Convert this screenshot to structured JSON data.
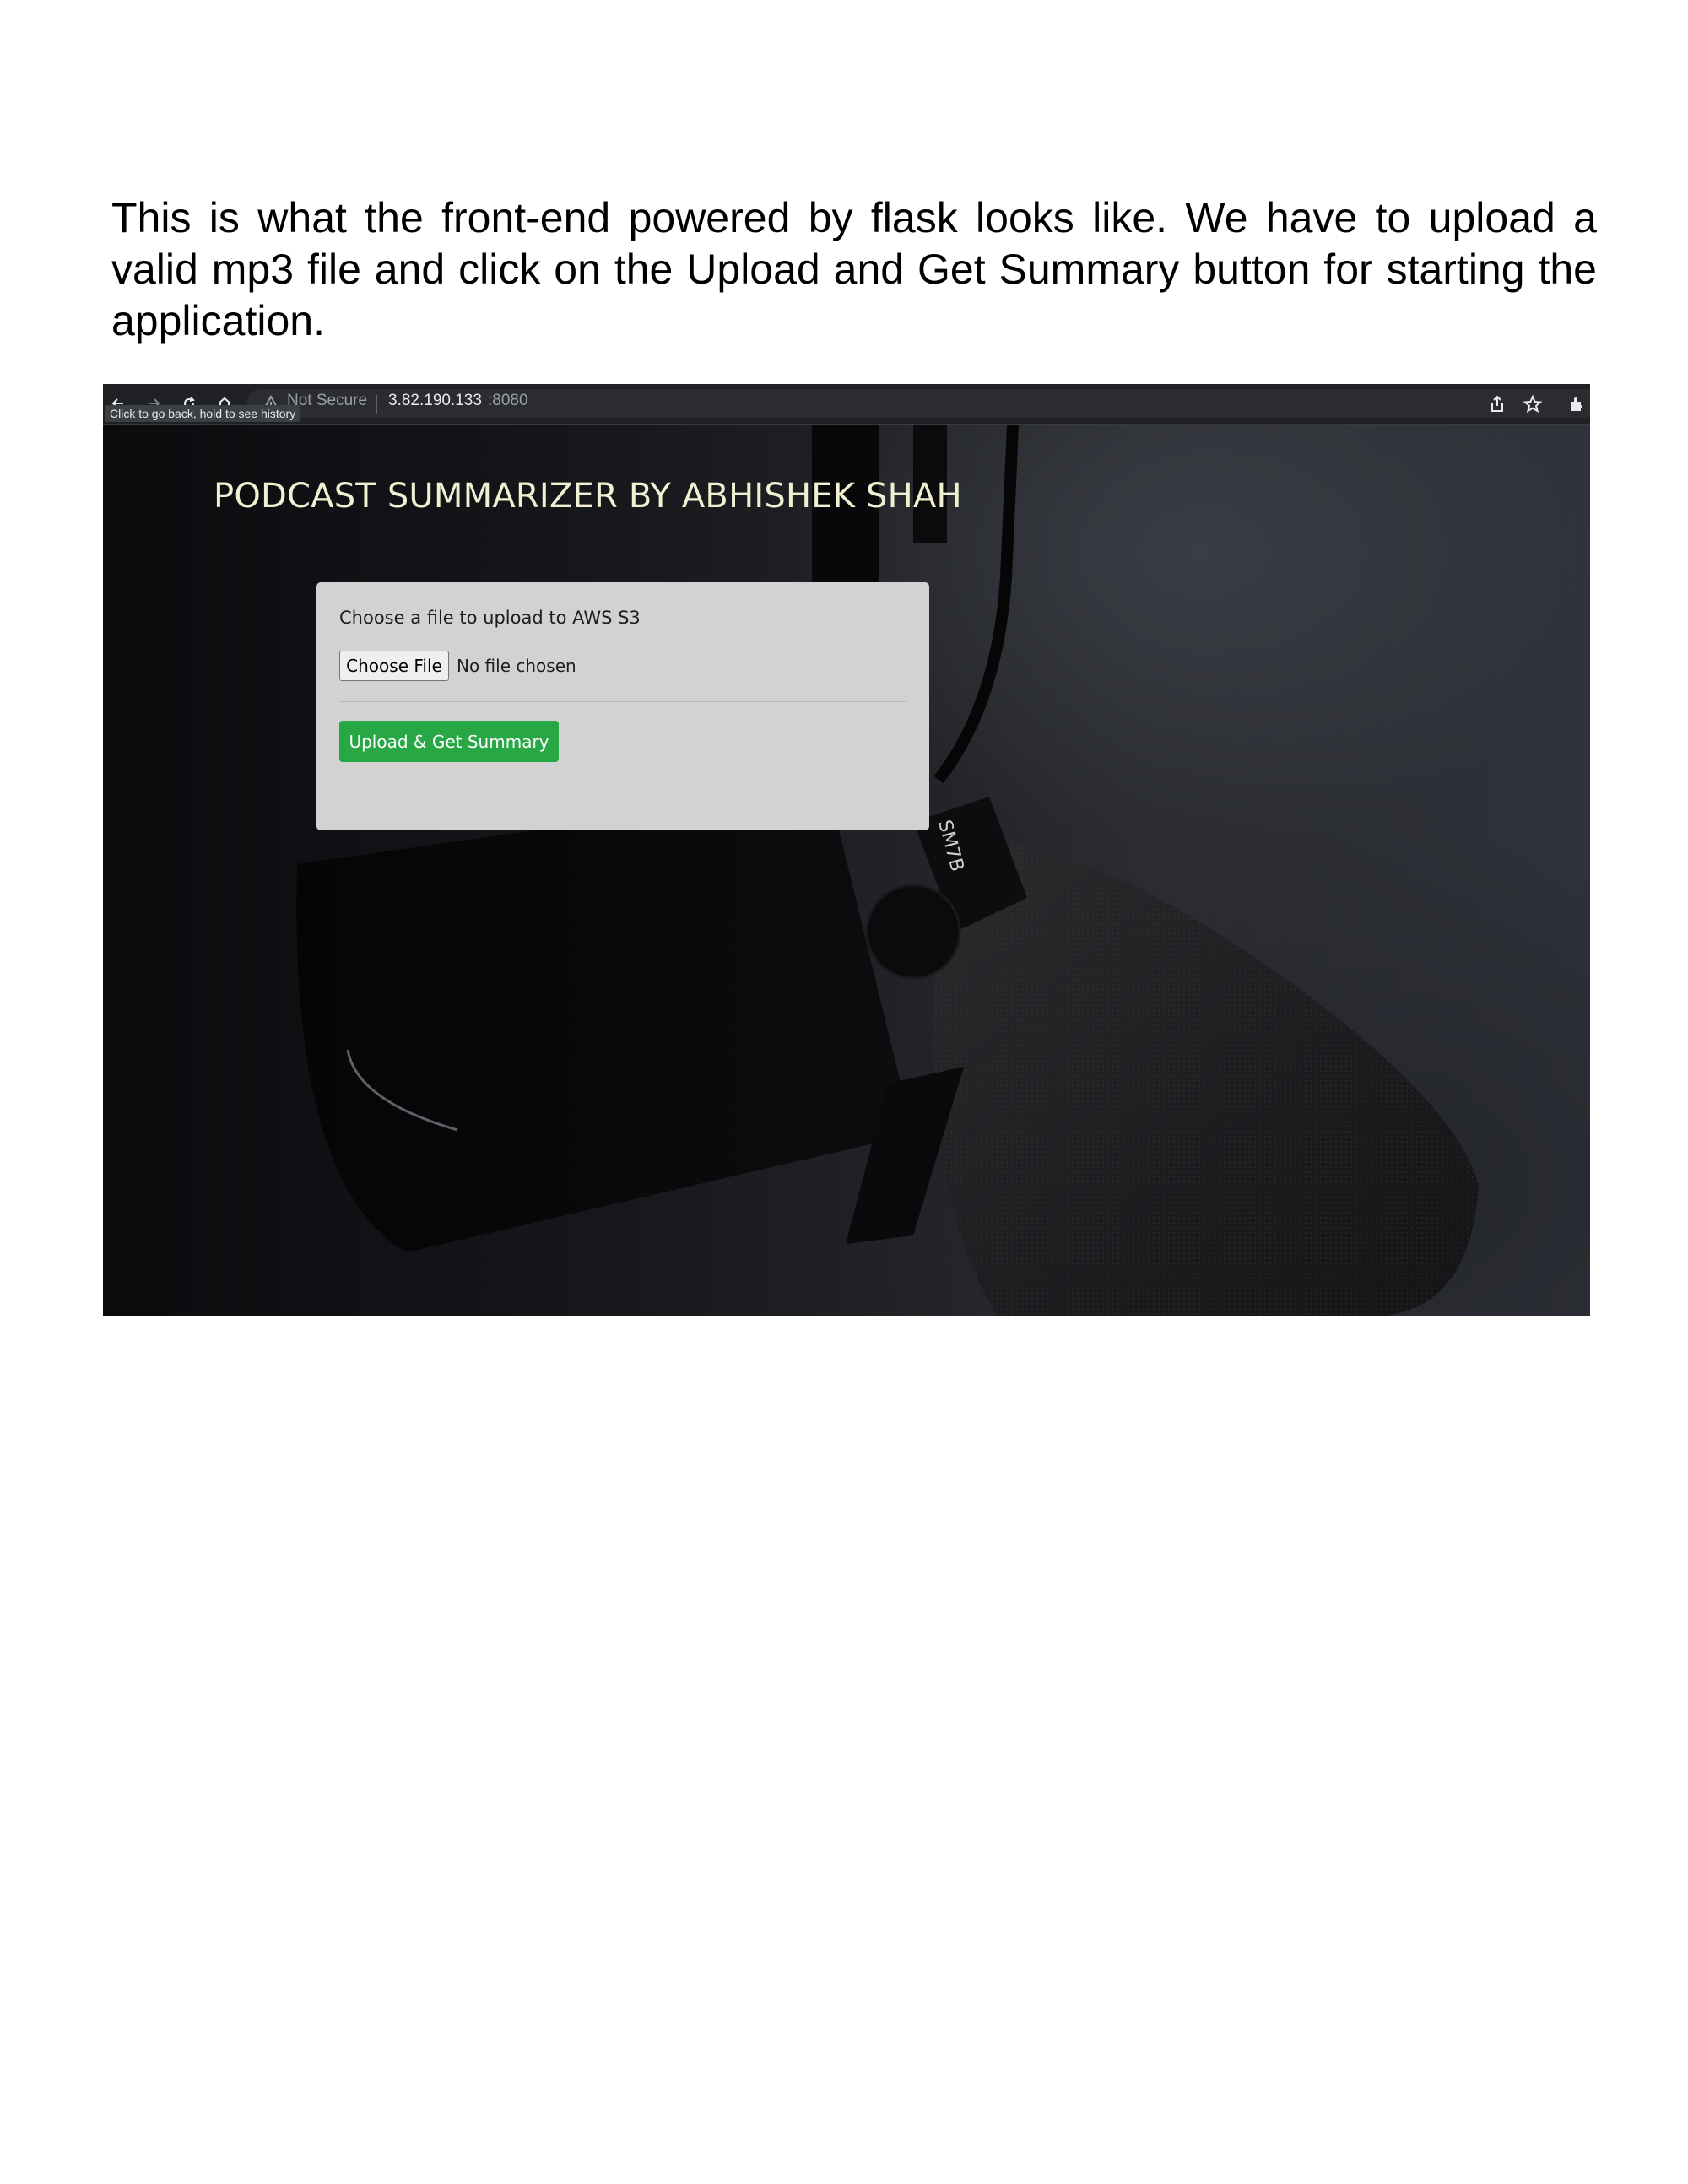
{
  "document": {
    "paragraph": "This is what the front-end powered by flask looks like. We have to upload a valid mp3 file and click on the Upload and Get Summary button for starting the application."
  },
  "browser": {
    "security_label": "Not Secure",
    "url_host": "3.82.190.133",
    "url_port": ":8080",
    "tooltip": "Click to go back, hold to see history",
    "icons": [
      "back-arrow-icon",
      "forward-arrow-icon",
      "reload-icon",
      "home-icon",
      "warning-icon",
      "share-icon",
      "star-icon",
      "extensions-icon"
    ]
  },
  "page": {
    "title": "PODCAST SUMMARIZER BY ABHISHEK SHAH",
    "upload_card": {
      "label": "Choose a file to upload to AWS S3",
      "file_button_label": "Choose File",
      "file_status": "No file chosen",
      "submit_label": "Upload & Get Summary"
    }
  },
  "colors": {
    "title": "#f1f0d2",
    "card_bg": "#d2d2d2",
    "submit_button": "#28a745",
    "chrome_bg": "#202124"
  }
}
